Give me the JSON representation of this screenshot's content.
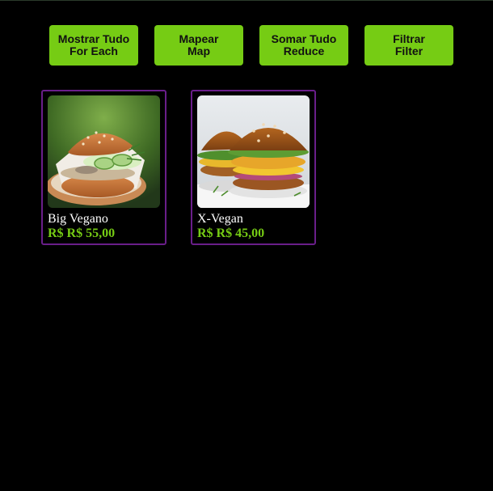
{
  "colors": {
    "background": "#000000",
    "button": "#76cc14",
    "card_border": "#6a1e8a",
    "price": "#76cc14"
  },
  "buttons": [
    {
      "line1": "Mostrar Tudo",
      "line2": "For Each"
    },
    {
      "line1": "Mapear",
      "line2": "Map"
    },
    {
      "line1": "Somar Tudo",
      "line2": "Reduce"
    },
    {
      "line1": "Filtrar",
      "line2": "Filter"
    }
  ],
  "products": [
    {
      "name": "Big Vegano",
      "price": "R$ R$ 55,00",
      "image": "burger-photo"
    },
    {
      "name": "X-Vegan",
      "price": "R$ R$ 45,00",
      "image": "burger-photo"
    }
  ]
}
